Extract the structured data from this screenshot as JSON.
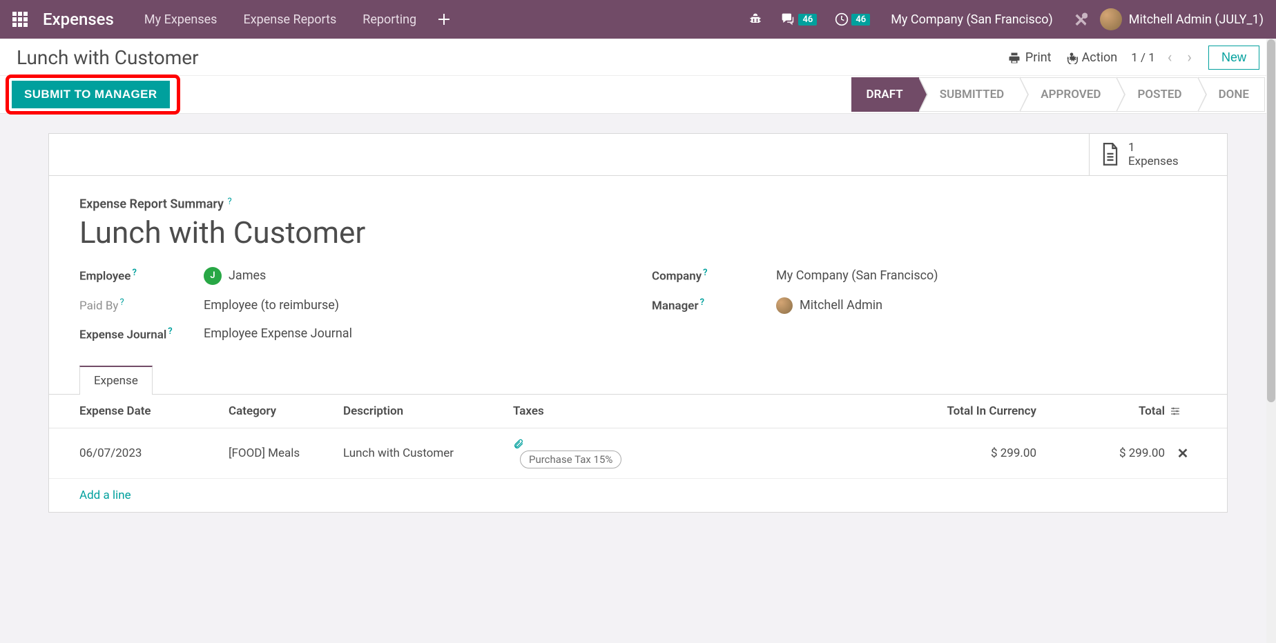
{
  "topnav": {
    "brand": "Expenses",
    "links": [
      "My Expenses",
      "Expense Reports",
      "Reporting"
    ],
    "discuss_badge": "46",
    "activity_badge": "46",
    "company": "My Company (San Francisco)",
    "user": "Mitchell Admin (JULY_1)"
  },
  "header": {
    "breadcrumb": "Lunch with Customer",
    "actions": {
      "print": "Print",
      "action": "Action"
    },
    "pager": "1 / 1",
    "new_btn": "New"
  },
  "statusbar": {
    "submit": "SUBMIT TO MANAGER",
    "steps": [
      "DRAFT",
      "SUBMITTED",
      "APPROVED",
      "POSTED",
      "DONE"
    ],
    "active_index": 0
  },
  "stat": {
    "count": "1",
    "label": "Expenses"
  },
  "form": {
    "section": "Expense Report Summary",
    "title": "Lunch with Customer",
    "labels": {
      "employee": "Employee",
      "company": "Company",
      "paid_by": "Paid By",
      "manager": "Manager",
      "journal": "Expense Journal"
    },
    "values": {
      "employee_initial": "J",
      "employee": "James",
      "company": "My Company (San Francisco)",
      "paid_by": "Employee (to reimburse)",
      "manager": "Mitchell Admin",
      "journal": "Employee Expense Journal"
    }
  },
  "tabs": {
    "expense": "Expense"
  },
  "table": {
    "headers": {
      "date": "Expense Date",
      "category": "Category",
      "description": "Description",
      "taxes": "Taxes",
      "total_currency": "Total In Currency",
      "total": "Total"
    },
    "rows": [
      {
        "date": "06/07/2023",
        "category": "[FOOD] Meals",
        "description": "Lunch with Customer",
        "tax": "Purchase Tax 15%",
        "total_currency": "$ 299.00",
        "total": "$ 299.00"
      }
    ],
    "add_line": "Add a line"
  }
}
